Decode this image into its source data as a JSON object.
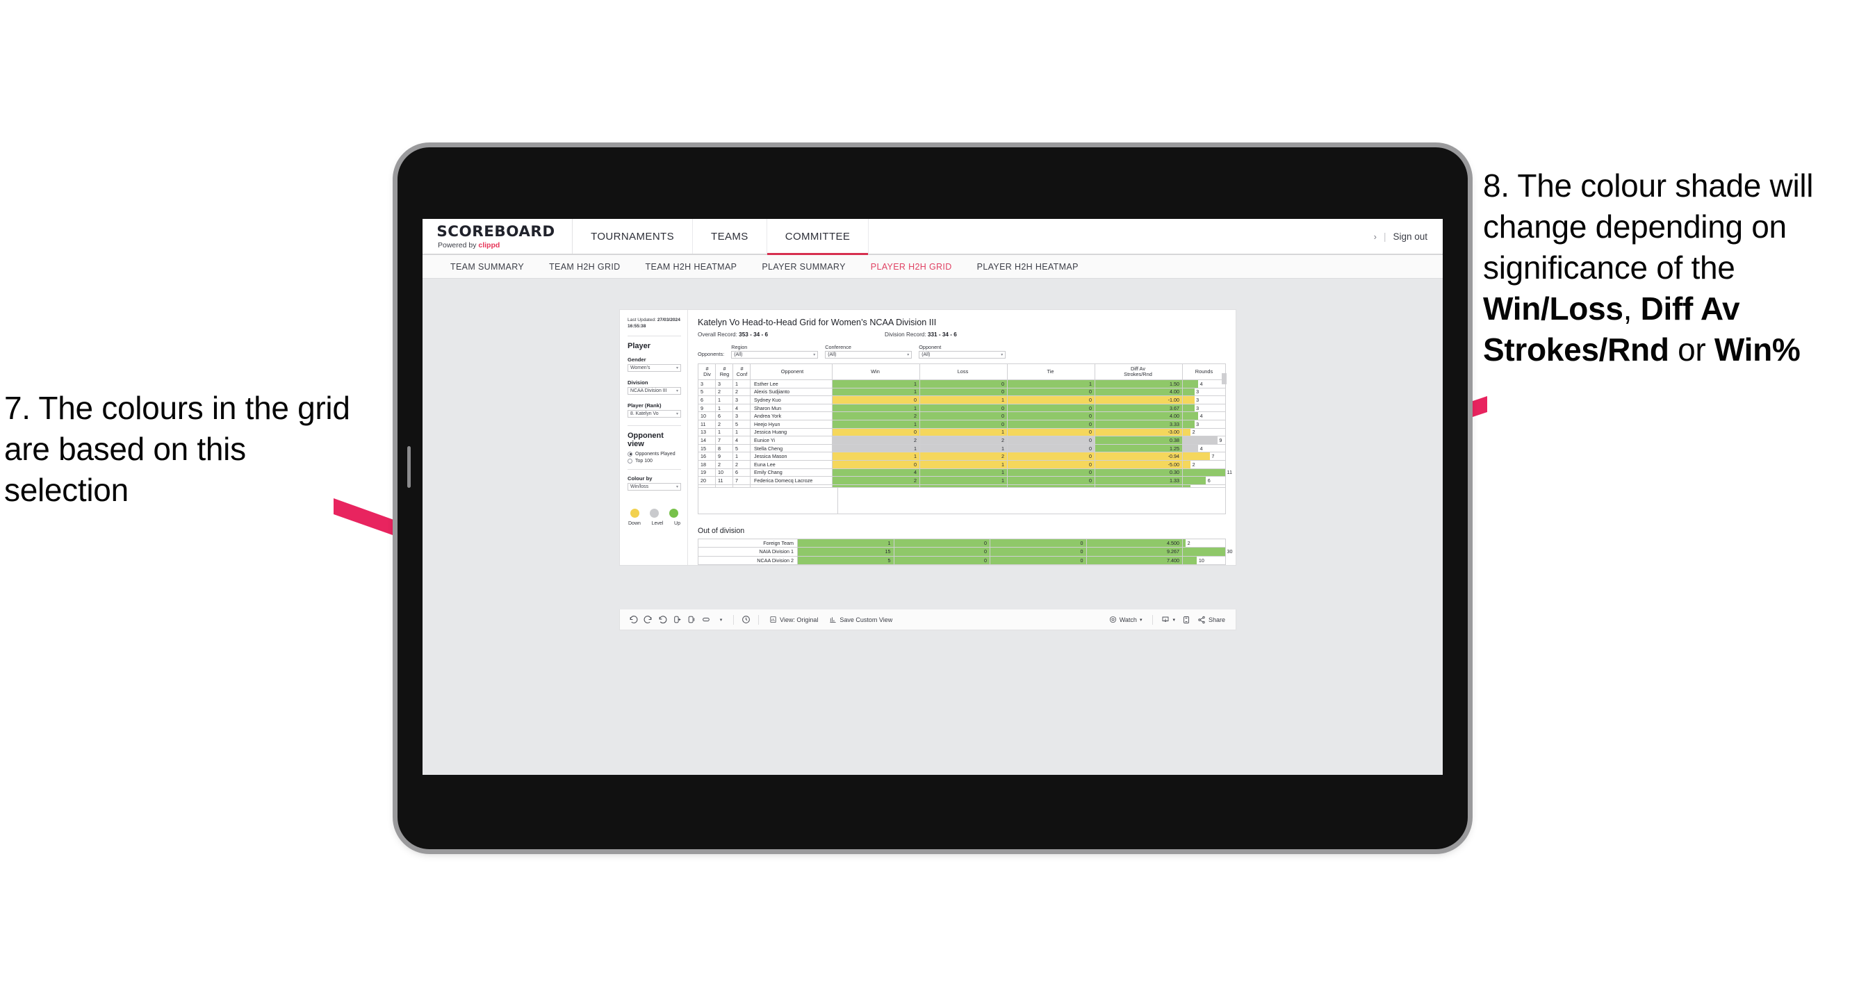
{
  "annotations": {
    "left": "7. The colours in the grid are based on this selection",
    "right_parts": [
      {
        "t": "8. The colour shade will change depending on significance of the ",
        "b": false
      },
      {
        "t": "Win/Loss",
        "b": true
      },
      {
        "t": ", ",
        "b": false
      },
      {
        "t": "Diff Av Strokes/Rnd",
        "b": true
      },
      {
        "t": " or ",
        "b": false
      },
      {
        "t": "Win%",
        "b": true
      }
    ],
    "arrow_color": "#E8245F"
  },
  "app": {
    "brand_main": "SCOREBOARD",
    "brand_sub_prefix": "Powered by ",
    "brand_sub_clippd": "clippd",
    "nav_tabs": [
      {
        "label": "TOURNAMENTS",
        "active": false
      },
      {
        "label": "TEAMS",
        "active": false
      },
      {
        "label": "COMMITTEE",
        "active": true
      }
    ],
    "chevron": "›",
    "separator": "|",
    "sign_out": "Sign out",
    "sub_tabs": [
      {
        "label": "TEAM SUMMARY",
        "active": false
      },
      {
        "label": "TEAM H2H GRID",
        "active": false
      },
      {
        "label": "TEAM H2H HEATMAP",
        "active": false
      },
      {
        "label": "PLAYER SUMMARY",
        "active": false
      },
      {
        "label": "PLAYER H2H GRID",
        "active": true
      },
      {
        "label": "PLAYER H2H HEATMAP",
        "active": false
      }
    ]
  },
  "sidebar": {
    "last_updated_label": "Last Updated: ",
    "last_updated_value": "27/03/2024",
    "last_updated_time": "16:55:38",
    "section_player": "Player",
    "gender_label": "Gender",
    "gender_value": "Women’s",
    "division_label": "Division",
    "division_value": "NCAA Division III",
    "player_label": "Player (Rank)",
    "player_value": "8. Katelyn Vo",
    "opponent_view_label": "Opponent view",
    "opponent_view_options": [
      {
        "label": "Opponents Played",
        "selected": true
      },
      {
        "label": "Top 100",
        "selected": false
      }
    ],
    "colour_by_label": "Colour by",
    "colour_by_value": "Win/loss",
    "legend": [
      {
        "label": "Down",
        "color": "#F2D14E"
      },
      {
        "label": "Level",
        "color": "#C9CACD"
      },
      {
        "label": "Up",
        "color": "#77C14A"
      }
    ],
    "caret": "▾"
  },
  "viz": {
    "title": "Katelyn Vo Head-to-Head Grid for Women’s NCAA Division III",
    "overall_record_label": "Overall Record: ",
    "overall_record_value": "353 -  34 - 6",
    "division_record_label": "Division Record: ",
    "division_record_value": "331 -  34 - 6",
    "opponents_label": "Opponents:",
    "filters": [
      {
        "caption": "Region",
        "value": "(All)"
      },
      {
        "caption": "Conference",
        "value": "(All)"
      },
      {
        "caption": "Opponent",
        "value": "(All)"
      }
    ],
    "out_of_division_title": "Out of division"
  },
  "chart_data": {
    "type": "table",
    "title": "Katelyn Vo Head-to-Head Grid for Women’s NCAA Division III",
    "columns": [
      "# Div",
      "# Reg",
      "# Conf",
      "Opponent",
      "Win",
      "Loss",
      "Tie",
      "Diff Av Strokes/Rnd",
      "Rounds"
    ],
    "column_headers_two_line": [
      {
        "l1": "#",
        "l2": "Div"
      },
      {
        "l1": "#",
        "l2": "Reg"
      },
      {
        "l1": "#",
        "l2": "Conf"
      },
      {
        "l1": "Opponent",
        "l2": ""
      },
      {
        "l1": "Win",
        "l2": ""
      },
      {
        "l1": "Loss",
        "l2": ""
      },
      {
        "l1": "Tie",
        "l2": ""
      },
      {
        "l1": "Diff Av",
        "l2": "Strokes/Rnd"
      },
      {
        "l1": "Rounds",
        "l2": ""
      }
    ],
    "rounds_max": 11,
    "rows": [
      {
        "div": "3",
        "reg": "3",
        "conf": "1",
        "opponent": "Esther Lee",
        "win": "1",
        "loss": "0",
        "tie": "1",
        "diff": "1.50",
        "rounds": "4",
        "rounds_n": 4,
        "status": "up"
      },
      {
        "div": "5",
        "reg": "2",
        "conf": "2",
        "opponent": "Alexis Sudjianto",
        "win": "1",
        "loss": "0",
        "tie": "0",
        "diff": "4.00",
        "rounds": "3",
        "rounds_n": 3,
        "status": "up"
      },
      {
        "div": "6",
        "reg": "1",
        "conf": "3",
        "opponent": "Sydney Kuo",
        "win": "0",
        "loss": "1",
        "tie": "0",
        "diff": "-1.00",
        "rounds": "3",
        "rounds_n": 3,
        "status": "down"
      },
      {
        "div": "9",
        "reg": "1",
        "conf": "4",
        "opponent": "Sharon Mun",
        "win": "1",
        "loss": "0",
        "tie": "0",
        "diff": "3.67",
        "rounds": "3",
        "rounds_n": 3,
        "status": "up"
      },
      {
        "div": "10",
        "reg": "6",
        "conf": "3",
        "opponent": "Andrea York",
        "win": "2",
        "loss": "0",
        "tie": "0",
        "diff": "4.00",
        "rounds": "4",
        "rounds_n": 4,
        "status": "up"
      },
      {
        "div": "11",
        "reg": "2",
        "conf": "5",
        "opponent": "Heejo Hyun",
        "win": "1",
        "loss": "0",
        "tie": "0",
        "diff": "3.33",
        "rounds": "3",
        "rounds_n": 3,
        "status": "up"
      },
      {
        "div": "13",
        "reg": "1",
        "conf": "1",
        "opponent": "Jessica Huang",
        "win": "0",
        "loss": "1",
        "tie": "0",
        "diff": "-3.00",
        "rounds": "2",
        "rounds_n": 2,
        "status": "down"
      },
      {
        "div": "14",
        "reg": "7",
        "conf": "4",
        "opponent": "Eunice Yi",
        "win": "2",
        "loss": "2",
        "tie": "0",
        "diff": "0.38",
        "rounds": "9",
        "rounds_n": 9,
        "status": "level",
        "diff_status": "up"
      },
      {
        "div": "15",
        "reg": "8",
        "conf": "5",
        "opponent": "Stella Cheng",
        "win": "1",
        "loss": "1",
        "tie": "0",
        "diff": "1.25",
        "rounds": "4",
        "rounds_n": 4,
        "status": "level",
        "diff_status": "up"
      },
      {
        "div": "16",
        "reg": "9",
        "conf": "1",
        "opponent": "Jessica Mason",
        "win": "1",
        "loss": "2",
        "tie": "0",
        "diff": "-0.94",
        "rounds": "7",
        "rounds_n": 7,
        "status": "down"
      },
      {
        "div": "18",
        "reg": "2",
        "conf": "2",
        "opponent": "Euna Lee",
        "win": "0",
        "loss": "1",
        "tie": "0",
        "diff": "-5.00",
        "rounds": "2",
        "rounds_n": 2,
        "status": "down"
      },
      {
        "div": "19",
        "reg": "10",
        "conf": "6",
        "opponent": "Emily Chang",
        "win": "4",
        "loss": "1",
        "tie": "0",
        "diff": "0.30",
        "rounds": "11",
        "rounds_n": 11,
        "status": "up"
      },
      {
        "div": "20",
        "reg": "11",
        "conf": "7",
        "opponent": "Federica Domecq Lacroze",
        "win": "2",
        "loss": "1",
        "tie": "0",
        "diff": "1.33",
        "rounds": "6",
        "rounds_n": 6,
        "status": "up"
      }
    ],
    "out_of_division": {
      "title": "Out of division",
      "rounds_max": 30,
      "rows": [
        {
          "label": "Foreign Team",
          "win": "1",
          "loss": "0",
          "tie": "0",
          "diff": "4.500",
          "rounds": "2",
          "rounds_n": 2,
          "status": "up"
        },
        {
          "label": "NAIA Division 1",
          "win": "15",
          "loss": "0",
          "tie": "0",
          "diff": "9.267",
          "rounds": "30",
          "rounds_n": 30,
          "status": "up"
        },
        {
          "label": "NCAA Division 2",
          "win": "5",
          "loss": "0",
          "tie": "0",
          "diff": "7.400",
          "rounds": "10",
          "rounds_n": 10,
          "status": "up"
        }
      ]
    },
    "colors": {
      "up": "#8FC869",
      "down": "#F5D75C",
      "level": "#CDCDCF"
    }
  },
  "toolbar": {
    "icons": [
      "undo-icon",
      "redo-icon",
      "revert-icon",
      "refresh-data-icon",
      "pause-icon",
      "highlight-icon",
      "caret-icon",
      "clock-icon"
    ],
    "view_label": "View: Original",
    "save_custom_view_label": "Save Custom View",
    "watch_label": "Watch",
    "share_label": "Share",
    "caret": "▾"
  }
}
